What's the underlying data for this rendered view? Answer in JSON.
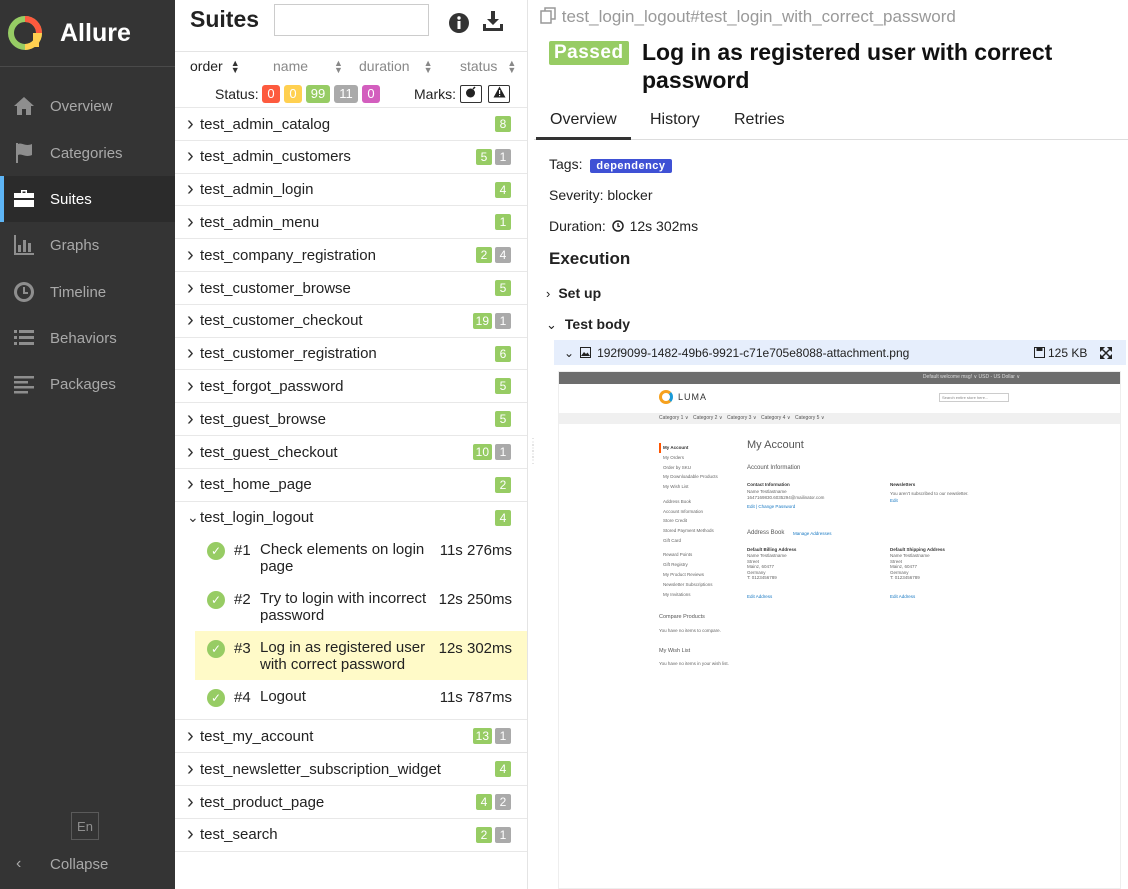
{
  "app": {
    "name": "Allure"
  },
  "sidebar": {
    "items": [
      {
        "label": "Overview",
        "icon": "home-icon"
      },
      {
        "label": "Categories",
        "icon": "flag-icon"
      },
      {
        "label": "Suites",
        "icon": "briefcase-icon",
        "active": true
      },
      {
        "label": "Graphs",
        "icon": "bar-chart-icon"
      },
      {
        "label": "Timeline",
        "icon": "clock-icon"
      },
      {
        "label": "Behaviors",
        "icon": "list-icon"
      },
      {
        "label": "Packages",
        "icon": "align-left-icon"
      }
    ],
    "language": "En",
    "collapse_label": "Collapse"
  },
  "suites": {
    "title": "Suites",
    "sort": {
      "order": "order",
      "name": "name",
      "duration": "duration",
      "status": "status"
    },
    "status_label": "Status:",
    "status_counts": {
      "failed": "0",
      "broken": "0",
      "passed": "99",
      "skipped": "11",
      "unknown": "0"
    },
    "marks_label": "Marks:",
    "rows": [
      {
        "name": "test_admin_catalog",
        "passed": "8"
      },
      {
        "name": "test_admin_customers",
        "passed": "5",
        "skipped": "1"
      },
      {
        "name": "test_admin_login",
        "passed": "4"
      },
      {
        "name": "test_admin_menu",
        "passed": "1"
      },
      {
        "name": "test_company_registration",
        "passed": "2",
        "skipped": "4"
      },
      {
        "name": "test_customer_browse",
        "passed": "5"
      },
      {
        "name": "test_customer_checkout",
        "passed": "19",
        "skipped": "1"
      },
      {
        "name": "test_customer_registration",
        "passed": "6"
      },
      {
        "name": "test_forgot_password",
        "passed": "5"
      },
      {
        "name": "test_guest_browse",
        "passed": "5"
      },
      {
        "name": "test_guest_checkout",
        "passed": "10",
        "skipped": "1"
      },
      {
        "name": "test_home_page",
        "passed": "2"
      },
      {
        "name": "test_login_logout",
        "passed": "4",
        "expanded": true
      },
      {
        "name": "test_my_account",
        "passed": "13",
        "skipped": "1"
      },
      {
        "name": "test_newsletter_subscription_widget",
        "passed": "4"
      },
      {
        "name": "test_product_page",
        "passed": "4",
        "skipped": "2"
      },
      {
        "name": "test_search",
        "passed": "2",
        "skipped": "1"
      }
    ],
    "children": [
      {
        "num": "#1",
        "name": "Check elements on login page",
        "duration": "11s 276ms"
      },
      {
        "num": "#2",
        "name": "Try to login with incorrect password",
        "duration": "12s 250ms"
      },
      {
        "num": "#3",
        "name": "Log in as registered user with correct password",
        "duration": "12s 302ms",
        "selected": true
      },
      {
        "num": "#4",
        "name": "Logout",
        "duration": "11s 787ms"
      }
    ]
  },
  "details": {
    "path": "test_login_logout#test_login_with_correct_password",
    "status": "Passed",
    "title": "Log in as registered user with correct password",
    "tabs": [
      "Overview",
      "History",
      "Retries"
    ],
    "tags_label": "Tags:",
    "tag": "dependency",
    "severity": "Severity: blocker",
    "duration_label": "Duration:",
    "duration": "12s 302ms",
    "execution_title": "Execution",
    "setup_label": "Set up",
    "test_body_label": "Test body",
    "attachment": {
      "name": "192f9099-1482-49b6-9921-c71e705e8088-attachment.png",
      "size": "125 KB"
    }
  },
  "screenshot": {
    "topbar": "Default welcome msg! ∨   USD - US Dollar ∨",
    "logo": "LUMA",
    "search_placeholder": "Search entire store here...",
    "categories": [
      "Category 1 ∨",
      "Category 2 ∨",
      "Category 3 ∨",
      "Category 4 ∨",
      "Category 5 ∨"
    ],
    "side_links": [
      "My Account",
      "My Orders",
      "Order by SKU",
      "My Downloadable Products",
      "My Wish List",
      "Address Book",
      "Account Information",
      "Store Credit",
      "Stored Payment Methods",
      "Gift Card",
      "Reward Points",
      "Gift Registry",
      "My Product Reviews",
      "Newsletter Subscriptions",
      "My Invitations"
    ],
    "page_title": "My Account",
    "account_info": "Account Information",
    "contact_info": "Contact Information",
    "contact_name": "Name Testlastname",
    "contact_email": "1647169830.6035294@mailinator.com",
    "edit_links": "Edit  |  Change Password",
    "newsletters": "Newsletters",
    "newsletters_text": "You aren't subscribed to our newsletter.",
    "edit": "Edit",
    "address_book": "Address Book",
    "manage_addresses": "Manage Addresses",
    "billing_title": "Default Billing Address",
    "shipping_title": "Default Shipping Address",
    "address_lines": "Name Testlastname\nStreet\nMainz, 60477\nGermany\nT: 0123456789",
    "edit_address": "Edit Address",
    "compare": "Compare Products",
    "compare_text": "You have no items to compare.",
    "wishlist": "My Wish List",
    "wishlist_text": "You have no items in your wish list."
  }
}
